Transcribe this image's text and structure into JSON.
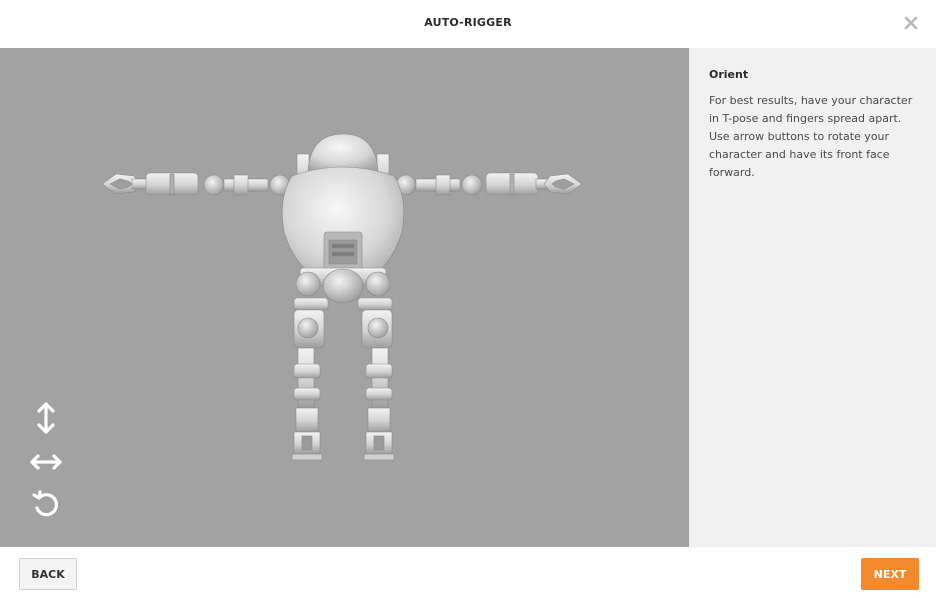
{
  "header": {
    "title": "AUTO-RIGGER",
    "close_icon": "close-icon"
  },
  "viewport": {
    "background": "#a2a2a2",
    "controls": [
      {
        "icon": "vertical-arrows-icon",
        "action": "rotate-vertical"
      },
      {
        "icon": "horizontal-arrows-icon",
        "action": "rotate-horizontal"
      },
      {
        "icon": "rotate-icon",
        "action": "rotate"
      }
    ]
  },
  "side_panel": {
    "title": "Orient",
    "body": "For best results, have your character in T-pose and fingers spread apart. Use arrow buttons to rotate your character and have its front face forward."
  },
  "footer": {
    "back_label": "BACK",
    "next_label": "NEXT",
    "accent": "#f48a2e"
  }
}
